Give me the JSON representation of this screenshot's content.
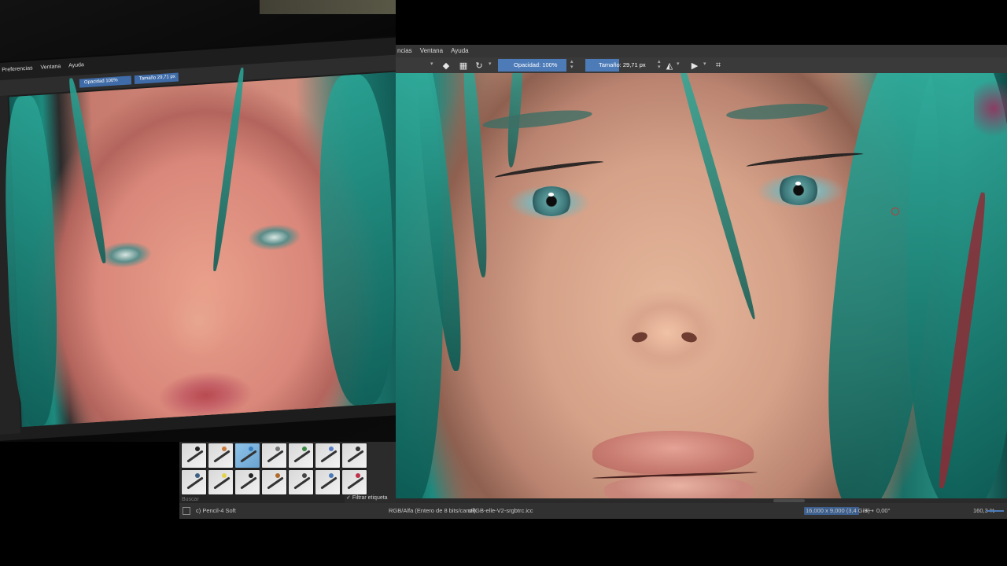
{
  "photo": {
    "menu": [
      "Preferencias",
      "Ventana",
      "Ayuda"
    ],
    "opacity_label": "Opacidad 100%",
    "size_label": "Tamaño 29,71 px"
  },
  "menubar": {
    "items": [
      "ncias",
      "Ventana",
      "Ayuda"
    ]
  },
  "toolbar": {
    "opacity_label": "Opacidad: 100%",
    "size_label": "Tamaño: 29,71 px",
    "icons": [
      "eraser-icon",
      "alpha-lock-icon",
      "reload-icon",
      "mirror-horizontal-icon",
      "mirror-vertical-icon",
      "wrap-around-icon"
    ]
  },
  "presets": {
    "search_placeholder": "Buscar",
    "filter_label": "Filtrar etiqueta",
    "filter_checked": true,
    "brush_count": 14,
    "selected_index": 2
  },
  "status": {
    "brush_name": "c) Pencil-4 Soft",
    "color_model": "RGB/Alfa (Entero de 8 bits/canal)",
    "profile": "sRGB-elle-V2-srgbtrc.icc",
    "dimensions": "16,000 x 9,000 (3,4 GiB)",
    "rotation": "0,00°",
    "zoom": "160,3 %"
  },
  "colors": {
    "accent": "#4c7bb8",
    "panel": "#303030",
    "toolbar": "#3a3a3a",
    "hair": "#2a9486"
  }
}
